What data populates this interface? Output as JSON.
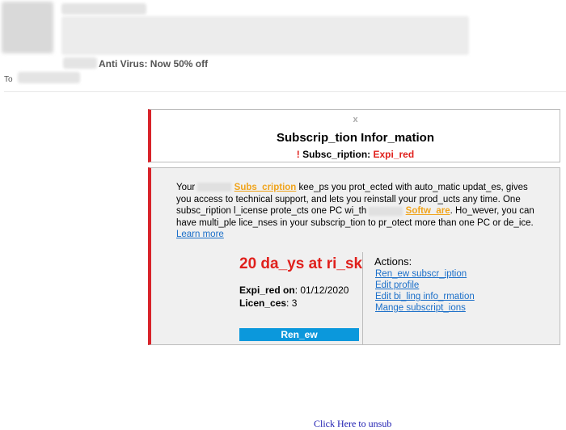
{
  "email": {
    "subject": "Anti Virus: Now 50% off",
    "to_label": "To"
  },
  "card_top": {
    "close": "x",
    "title": "Subscrip_tion Infor_mation",
    "status_mark": "!",
    "status_label": "Subsc_ription:",
    "status_value": "Expi_red"
  },
  "body_text": {
    "p1": "Your",
    "link_subscription": "Subs_cription",
    "p2": "kee_ps you prot_ected with auto_matic updat_es, gives you access to technical support, and lets you reinstall your prod_ucts any time. One subsc_ription l_icense prote_cts one PC wi_th",
    "link_software": "Softw_are",
    "p3": ". Ho_wever, you can have multi_ple lice_nses in your subscrip_tion to pr_otect more than one PC or de_ice.",
    "learn_more": "Learn more"
  },
  "status": {
    "days_at_risk": "20 da_ys at ri_sk",
    "expired_label": "Expi_red on",
    "expired_date": ": 01/12/2020",
    "licences_label": "Licen_ces",
    "licences_value": ": 3"
  },
  "renew_button": "Ren_ew",
  "actions": {
    "heading": "Actions:",
    "items": [
      "Ren_ew subscr_iption",
      "Edit profile",
      "Edit bi_ling info_rmation",
      "Mange subscript_ions"
    ]
  },
  "footer": {
    "unsub": "Click Here to unsub"
  },
  "colors": {
    "accent_red": "#e0201c",
    "button_blue": "#0b98dc",
    "link_orange": "#f0a41c",
    "link_blue": "#1b6fc9"
  }
}
